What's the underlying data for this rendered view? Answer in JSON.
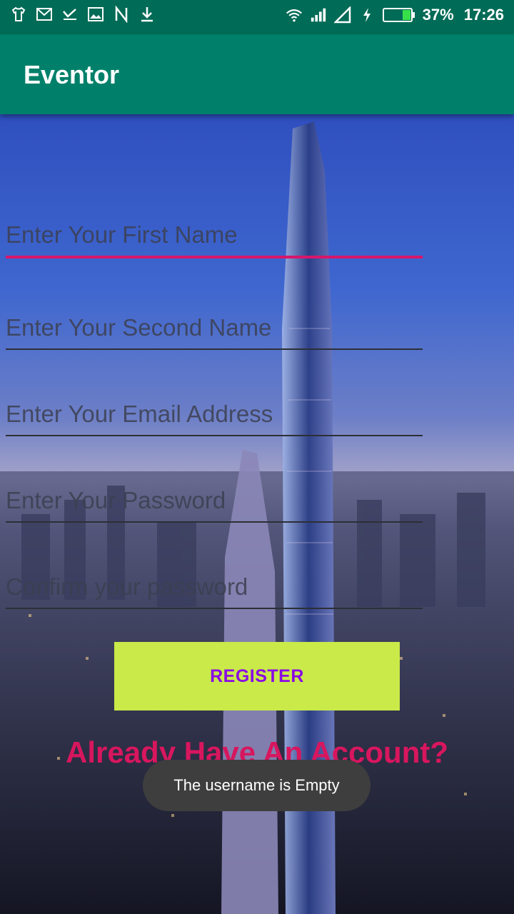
{
  "statusbar": {
    "left_icons": [
      "tshirt-icon",
      "gmail-icon",
      "check-icon",
      "image-icon",
      "n-icon",
      "download-icon"
    ],
    "right_icons": [
      "wifi-icon",
      "signal-icon",
      "signal-empty-icon",
      "charging-icon",
      "battery-icon"
    ],
    "battery_percent": "37%",
    "time": "17:26"
  },
  "appbar": {
    "title": "Eventor"
  },
  "form": {
    "first_name_placeholder": "Enter Your First Name",
    "second_name_placeholder": "Enter Your Second Name",
    "email_placeholder": "Enter Your Email Address",
    "password_placeholder": "Enter Your Password",
    "confirm_password_placeholder": "Confirm your password",
    "register_label": "REGISTER",
    "already_account_text": "Already Have An Account?"
  },
  "toast": {
    "message": "The username is Empty"
  },
  "colors": {
    "statusbar": "#006b56",
    "appbar": "#00806a",
    "register_button": "#c9ea48",
    "register_text": "#8a08e6",
    "accent": "#d6176b"
  }
}
